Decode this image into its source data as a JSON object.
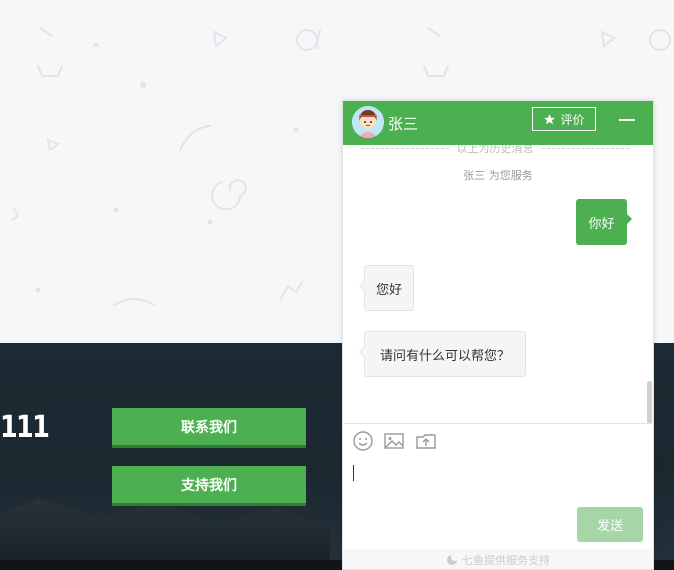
{
  "page": {
    "phone_partial": "111",
    "buttons": {
      "contact": "联系我们",
      "support": "支持我们"
    }
  },
  "chat": {
    "header": {
      "agent_name": "张三",
      "rate_label": "评价",
      "avatar_icon": "agent-avatar",
      "minimize_icon": "minus-icon"
    },
    "history_text": "以上为历史消息",
    "service_notice": "张三 为您服务",
    "messages": [
      {
        "from": "user",
        "text": "你好"
      },
      {
        "from": "agent",
        "text": "您好"
      },
      {
        "from": "agent",
        "text": "请问有什么可以帮您？"
      }
    ],
    "toolbar": {
      "icons": [
        "smiley-icon",
        "image-icon",
        "upload-icon"
      ]
    },
    "input": {
      "value": ""
    },
    "send_label": "发送",
    "powered_by": "七鱼提供服务支持"
  },
  "colors": {
    "accent": "#4caf50",
    "accent_dark": "#2e7d32",
    "send_disabled": "#a5d6a7",
    "bg_light": "#f6f7f9",
    "bg_dark": "#1d2b34"
  }
}
